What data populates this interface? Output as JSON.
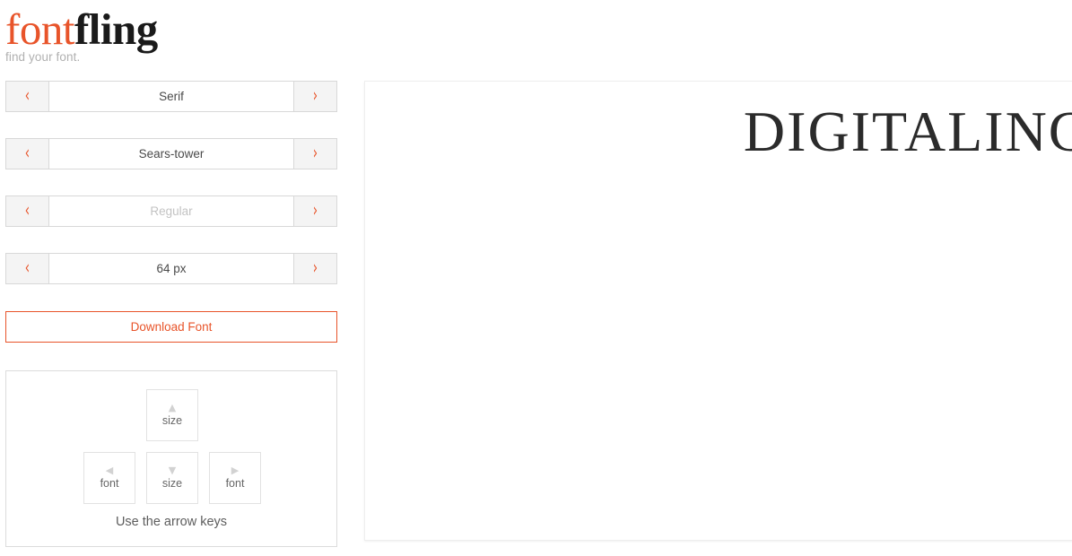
{
  "brand": {
    "name_part_1": "font",
    "name_part_2": "fling",
    "tagline": "find your font.",
    "accent_color": "#E8542A",
    "dark_color": "#1a1a1a"
  },
  "selectors": [
    {
      "name": "category",
      "value": "Serif",
      "muted": false,
      "prev_icon": "chevron-left-icon",
      "next_icon": "chevron-right-icon",
      "prev_glyph": "‹",
      "next_glyph": "›"
    },
    {
      "name": "font",
      "value": "Sears-tower",
      "muted": false,
      "prev_icon": "chevron-left-icon",
      "next_icon": "chevron-right-icon",
      "prev_glyph": "‹",
      "next_glyph": "›"
    },
    {
      "name": "style",
      "value": "Regular",
      "muted": true,
      "prev_icon": "chevron-left-icon",
      "next_icon": "chevron-right-icon",
      "prev_glyph": "‹",
      "next_glyph": "›"
    },
    {
      "name": "size",
      "value": "64 px",
      "muted": false,
      "prev_icon": "chevron-left-icon",
      "next_icon": "chevron-right-icon",
      "prev_glyph": "‹",
      "next_glyph": "›"
    }
  ],
  "download": {
    "label": "Download Font",
    "color": "#E8542A"
  },
  "hint": {
    "caption": "Use the arrow keys",
    "keys": {
      "up": {
        "glyph": "▲",
        "label": "size",
        "icon": "arrow-up-icon"
      },
      "left": {
        "glyph": "◀",
        "label": "font",
        "icon": "arrow-left-icon"
      },
      "down": {
        "glyph": "▼",
        "label": "size",
        "icon": "arrow-down-icon"
      },
      "right": {
        "glyph": "▶",
        "label": "font",
        "icon": "arrow-right-icon"
      }
    }
  },
  "preview": {
    "text": "DIGITALING",
    "font_size_px": "64 px",
    "color": "#2b2b2b"
  }
}
